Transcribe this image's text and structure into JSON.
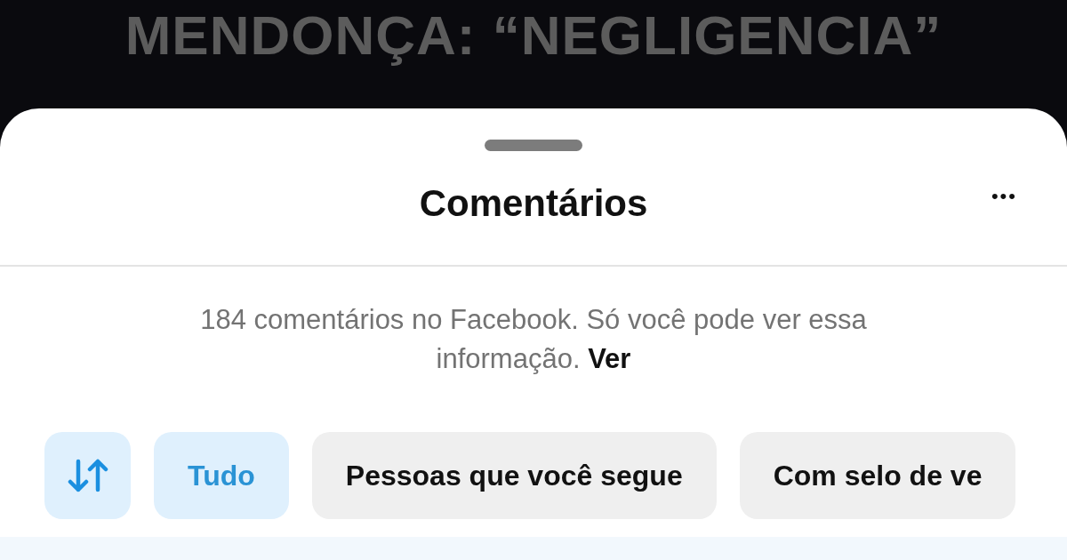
{
  "background": {
    "headline": "MENDONÇA: “NEGLIGENCIA”"
  },
  "sheet": {
    "title": "Comentários",
    "more_button": "•••",
    "info": "184 comentários no Facebook. Só você pode ver essa informação. **Ver**",
    "filters": [
      {
        "label": "Tudo",
        "selected": true
      },
      {
        "label": "Pessoas que você segue",
        "selected": false
      },
      {
        "label": "Com selo de ve",
        "selected": false
      }
    ]
  }
}
